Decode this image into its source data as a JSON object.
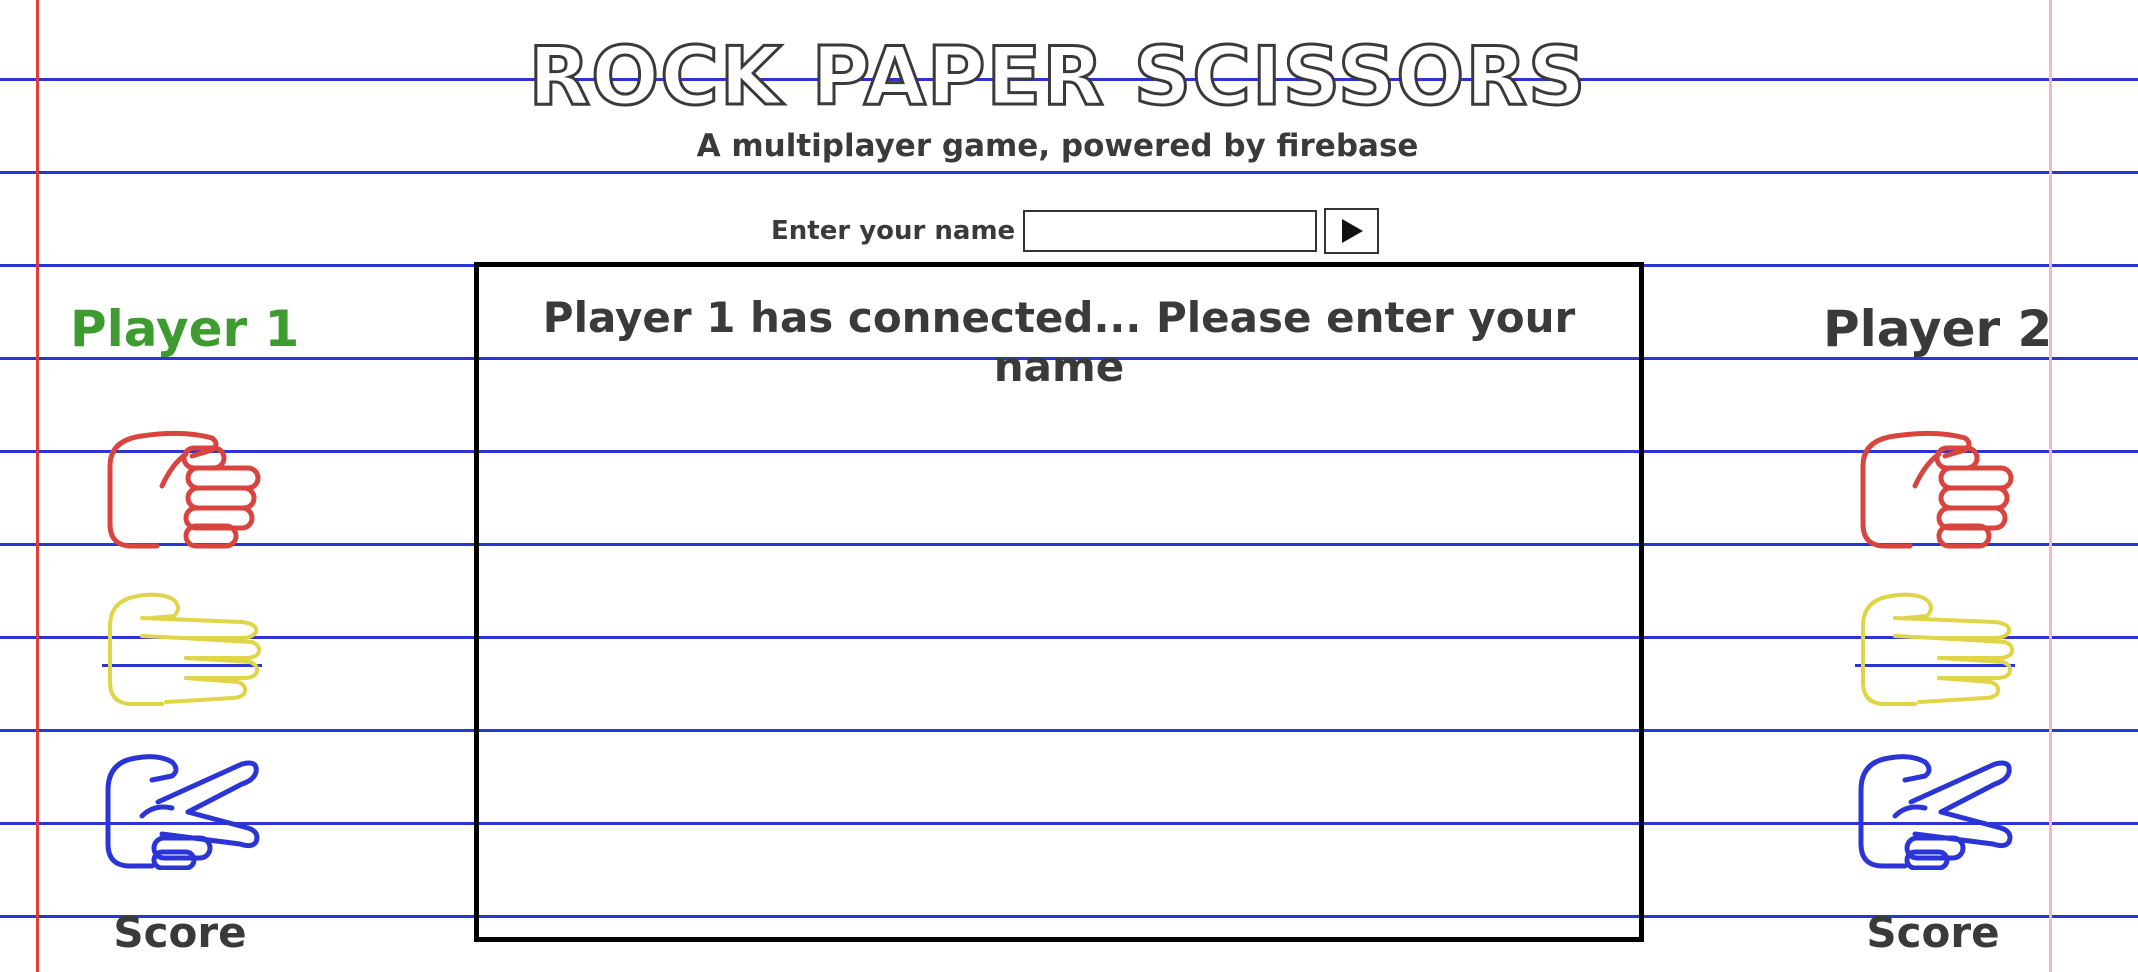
{
  "header": {
    "title": "ROCK PAPER SCISSORS",
    "subtitle": "A multiplayer game, powered by firebase"
  },
  "name_form": {
    "label": "Enter your name",
    "input_value": "",
    "submit_icon": "play-icon"
  },
  "game": {
    "message": "Player 1 has connected... Please enter your name"
  },
  "players": [
    {
      "name": "Player 1",
      "name_color": "#3e9b2f",
      "choices": [
        {
          "name": "rock",
          "icon": "rock-hand-icon",
          "color": "#d9443f"
        },
        {
          "name": "paper",
          "icon": "paper-hand-icon",
          "color": "#e0d448"
        },
        {
          "name": "scissors",
          "icon": "scissors-hand-icon",
          "color": "#2b35d6"
        }
      ],
      "score_label": "Score"
    },
    {
      "name": "Player 2",
      "name_color": "#3a3a3a",
      "choices": [
        {
          "name": "rock",
          "icon": "rock-hand-icon",
          "color": "#d9443f"
        },
        {
          "name": "paper",
          "icon": "paper-hand-icon",
          "color": "#e0d448"
        },
        {
          "name": "scissors",
          "icon": "scissors-hand-icon",
          "color": "#2b35d6"
        }
      ],
      "score_label": "Score"
    }
  ],
  "colors": {
    "paper_line": "#2b35d6",
    "margin_line": "#e23b3b",
    "right_margin_line": "#f3b9c0",
    "text": "#3a3a3a"
  }
}
